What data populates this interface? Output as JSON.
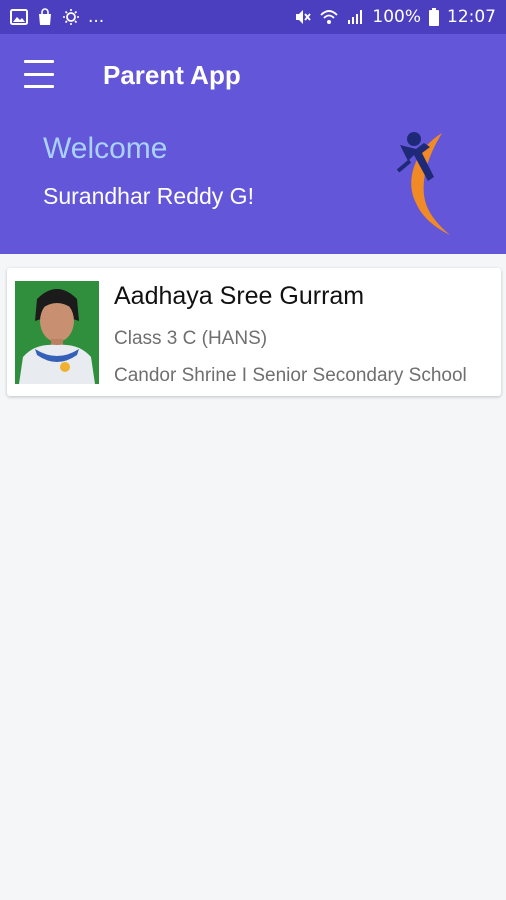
{
  "status_bar": {
    "left_icons": [
      "image-icon",
      "shopping-bag-icon",
      "sun-icon"
    ],
    "overflow": "...",
    "battery": "100%",
    "time": "12:07"
  },
  "header": {
    "title": "Parent App",
    "welcome": "Welcome",
    "user_name": "Surandhar Reddy G!",
    "colors": {
      "bar": "#6356d9",
      "status": "#4c3fbf",
      "welcome": "#a9d2ff",
      "logo_dark": "#1e2a78",
      "logo_orange": "#f08a24"
    }
  },
  "students": [
    {
      "name": "Aadhaya Sree Gurram",
      "class": "Class 3 C (HANS)",
      "school": "Candor Shrine I Senior Secondary School"
    }
  ]
}
